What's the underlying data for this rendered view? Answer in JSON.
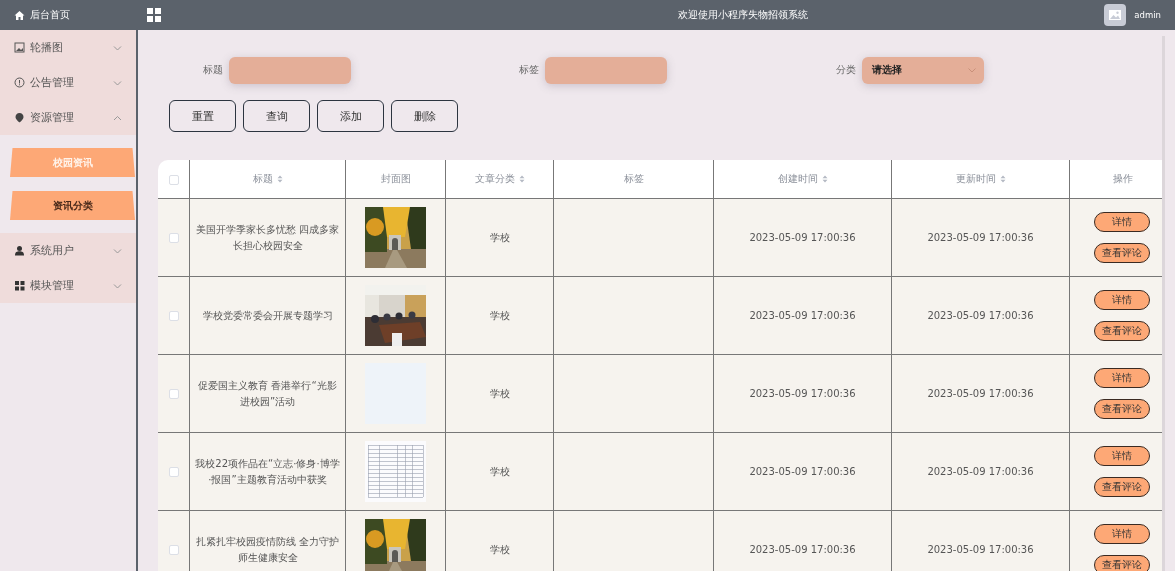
{
  "sidebar": {
    "home": {
      "label": "后台首页"
    },
    "items": [
      {
        "label": "轮播图",
        "expanded": false
      },
      {
        "label": "公告管理",
        "expanded": false
      },
      {
        "label": "资源管理",
        "expanded": true,
        "children": [
          {
            "label": "校园资讯",
            "selected": true
          },
          {
            "label": "资讯分类",
            "selected": false
          }
        ]
      },
      {
        "label": "系统用户",
        "expanded": false
      },
      {
        "label": "模块管理",
        "expanded": false
      }
    ]
  },
  "header": {
    "title": "欢迎使用小程序失物招领系统",
    "user": "admin"
  },
  "search": {
    "fields": [
      {
        "label": "标题",
        "kind": "text"
      },
      {
        "label": "标签",
        "kind": "text"
      },
      {
        "label": "分类",
        "kind": "select",
        "placeholder": "请选择"
      }
    ],
    "buttons": [
      "重置",
      "查询",
      "添加",
      "删除"
    ]
  },
  "table": {
    "select_all": {
      "checked": false
    },
    "columns": [
      {
        "label": "标题",
        "sortable": true
      },
      {
        "label": "封面图",
        "sortable": false
      },
      {
        "label": "文章分类",
        "sortable": true
      },
      {
        "label": "标签",
        "sortable": false
      },
      {
        "label": "创建时间",
        "sortable": true
      },
      {
        "label": "更新时间",
        "sortable": true
      },
      {
        "label": "操作",
        "sortable": false
      }
    ],
    "rows": [
      {
        "checked": false,
        "title": "美国开学季家长多忧愁 四成多家长担心校园安全",
        "cover": {
          "kind": "picture"
        },
        "category": "学校",
        "created": "2023-05-09 17:00:36",
        "updated": "2023-05-09 17:00:36",
        "actions": [
          "详情",
          "查看评论"
        ]
      },
      {
        "checked": false,
        "title": "学校党委常委会开展专题学习",
        "cover": {
          "kind": "picture"
        },
        "category": "学校",
        "created": "2023-05-09 17:00:36",
        "updated": "2023-05-09 17:00:36",
        "actions": [
          "详情",
          "查看评论"
        ]
      },
      {
        "checked": false,
        "title": "促爱国主义教育 香港举行“光影进校园”活动",
        "cover": {
          "kind": "blank"
        },
        "category": "学校",
        "created": "2023-05-09 17:00:36",
        "updated": "2023-05-09 17:00:36",
        "actions": [
          "详情",
          "查看评论"
        ]
      },
      {
        "checked": false,
        "title": "我校22项作品在“立志·修身·博学·报国”主题教育活动中获奖",
        "cover": {
          "kind": "document"
        },
        "category": "学校",
        "created": "2023-05-09 17:00:36",
        "updated": "2023-05-09 17:00:36",
        "actions": [
          "详情",
          "查看评论"
        ]
      },
      {
        "checked": false,
        "title": "扎紧扎牢校园疫情防线 全力守护师生健康安全",
        "cover": {
          "kind": "picture"
        },
        "category": "学校",
        "created": "2023-05-09 17:00:36",
        "updated": "2023-05-09 17:00:36",
        "actions": [
          "详情",
          "查看评论"
        ]
      }
    ]
  }
}
